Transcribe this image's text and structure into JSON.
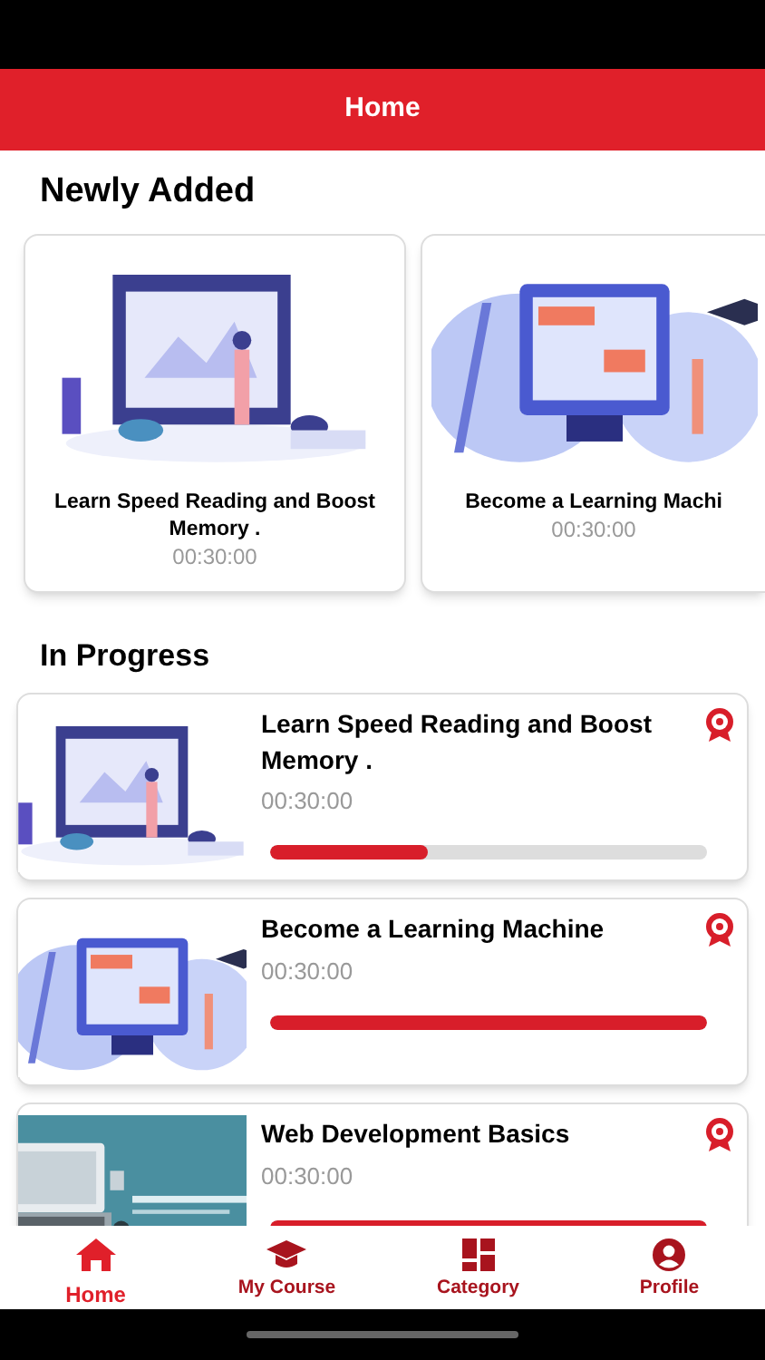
{
  "header": {
    "title": "Home"
  },
  "newly_added": {
    "heading": "Newly Added",
    "courses": [
      {
        "title": "Learn Speed Reading and Boost Memory .",
        "duration": "00:30:00"
      },
      {
        "title": "Become a Learning Machi",
        "duration": "00:30:00"
      }
    ]
  },
  "in_progress": {
    "heading": "In Progress",
    "courses": [
      {
        "title": "Learn Speed Reading and Boost Memory .",
        "duration": "00:30:00",
        "level": 0.36
      },
      {
        "title": "Become a Learning Machine",
        "duration": "00:30:00",
        "level": 1
      },
      {
        "title": "Web Development Basics",
        "duration": "00:30:00",
        "level": 1
      }
    ]
  },
  "bottom_nav": [
    {
      "label": "Home",
      "kind": "home",
      "selected": true
    },
    {
      "label": "My Course",
      "kind": "courses",
      "selected": false
    },
    {
      "label": "Category",
      "kind": "category",
      "selected": false
    },
    {
      "label": "Profile",
      "kind": "profile",
      "selected": false
    }
  ]
}
